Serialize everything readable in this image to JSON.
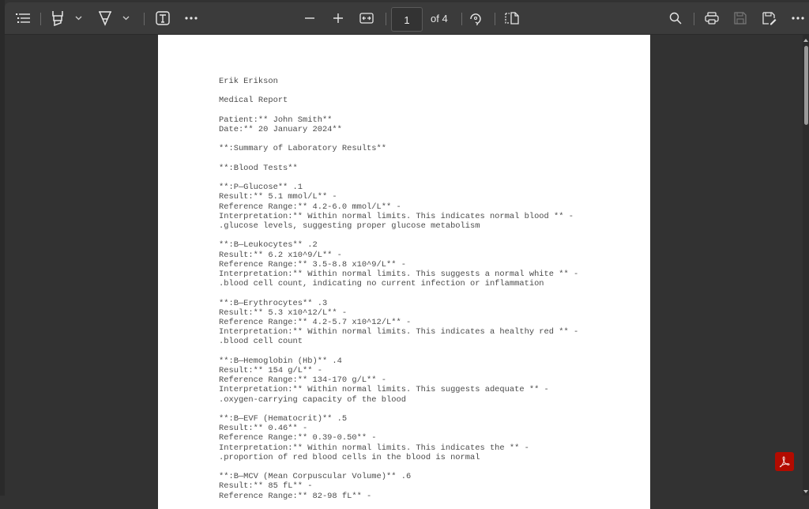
{
  "toolbar": {
    "icons": {
      "contents": "table-of-contents-icon",
      "highlight": "highlighter-icon",
      "highlight_dropdown": "chevron-down-icon",
      "draw": "draw-pen-icon",
      "draw_dropdown": "chevron-down-icon",
      "text": "add-text-icon",
      "more_left": "more-options-icon",
      "zoom_out": "minus-icon",
      "zoom_in": "plus-icon",
      "fit": "fit-to-width-icon",
      "rotate": "rotate-icon",
      "page_view": "page-view-icon",
      "search": "search-icon",
      "print": "print-icon",
      "save": "save-icon",
      "save_as": "save-as-icon",
      "more_right": "more-options-icon"
    },
    "current_page": "1",
    "page_total_label": "of 4"
  },
  "document": {
    "lines": [
      "Erik Erikson",
      "",
      "Medical Report",
      "",
      "Patient:** John Smith**",
      "Date:** 20 January 2024**",
      "",
      "**:Summary of Laboratory Results**",
      "",
      "**:Blood Tests**",
      "",
      "**:P—Glucose** .1",
      "Result:** 5.1 mmol/L** -",
      "Reference Range:** 4.2-6.0 mmol/L** -",
      "Interpretation:** Within normal limits. This indicates normal blood ** -",
      ".glucose levels, suggesting proper glucose metabolism",
      "",
      "**:B—Leukocytes** .2",
      "Result:** 6.2 x10^9/L** -",
      "Reference Range:** 3.5-8.8 x10^9/L** -",
      "Interpretation:** Within normal limits. This suggests a normal white ** -",
      ".blood cell count, indicating no current infection or inflammation",
      "",
      "**:B—Erythrocytes** .3",
      "Result:** 5.3 x10^12/L** -",
      "Reference Range:** 4.2-5.7 x10^12/L** -",
      "Interpretation:** Within normal limits. This indicates a healthy red ** -",
      ".blood cell count",
      "",
      "**:B—Hemoglobin (Hb)** .4",
      "Result:** 154 g/L** -",
      "Reference Range:** 134-170 g/L** -",
      "Interpretation:** Within normal limits. This suggests adequate ** -",
      ".oxygen-carrying capacity of the blood",
      "",
      "**:B—EVF (Hematocrit)** .5",
      "Result:** 0.46** -",
      "Reference Range:** 0.39-0.50** -",
      "Interpretation:** Within normal limits. This indicates the ** -",
      ".proportion of red blood cells in the blood is normal",
      "",
      "**:B—MCV (Mean Corpuscular Volume)** .6",
      "Result:** 85 fL** -",
      "Reference Range:** 82-98 fL** -"
    ]
  },
  "floating": {
    "acrobat_icon": "adobe-acrobat-icon",
    "brand_color": "#b30b00"
  }
}
